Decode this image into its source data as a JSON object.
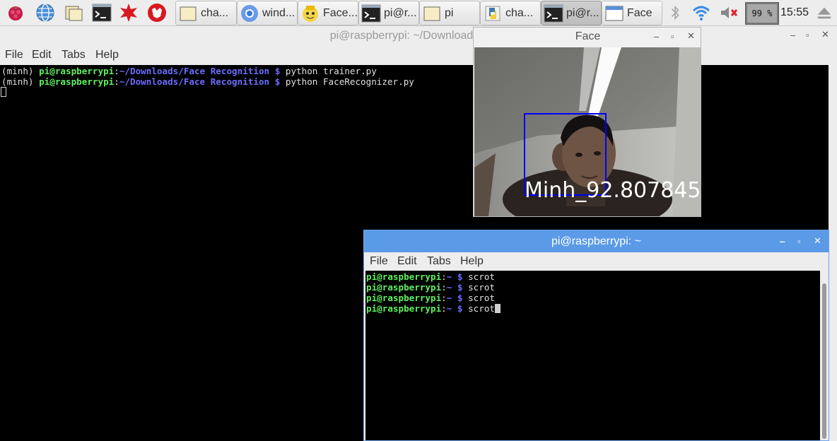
{
  "taskbar": {
    "launchers": [
      {
        "icon": "raspberry-menu-icon"
      },
      {
        "icon": "web-browser-icon"
      },
      {
        "icon": "file-manager-icon"
      },
      {
        "icon": "terminal-icon"
      },
      {
        "icon": "mathematica-icon"
      },
      {
        "icon": "wolfram-icon"
      }
    ],
    "tasks": [
      {
        "label": "cha...",
        "icon": "folder-icon",
        "active": false
      },
      {
        "label": "wind...",
        "icon": "chromium-icon",
        "active": false
      },
      {
        "label": "Face...",
        "icon": "geany-icon",
        "active": false
      },
      {
        "label": "pi@r...",
        "icon": "terminal-icon",
        "active": false
      },
      {
        "label": "pi",
        "icon": "folder-icon",
        "active": false
      },
      {
        "label": "cha...",
        "icon": "python-icon",
        "active": false
      },
      {
        "label": "pi@r...",
        "icon": "terminal-icon",
        "active": true
      },
      {
        "label": "Face",
        "icon": "window-icon",
        "active": false
      }
    ],
    "tray": {
      "bluetooth_icon": "bluetooth-icon",
      "wifi_icon": "wifi-icon",
      "volume_icon": "volume-muted-icon",
      "battery_text": "99 %",
      "battery_level": 0.99,
      "clock": "15:55",
      "eject_icon": "eject-icon"
    }
  },
  "bg_terminal": {
    "title": "pi@raspberrypi: ~/Downloads/Face",
    "menu": [
      "File",
      "Edit",
      "Tabs",
      "Help"
    ],
    "lines": [
      {
        "env": "(minh) ",
        "user": "pi@raspberrypi",
        "colon": ":",
        "path": "~/Downloads/Face Recognition",
        "prompt": " $ ",
        "cmd": "python trainer.py"
      },
      {
        "env": "(minh) ",
        "user": "pi@raspberrypi",
        "colon": ":",
        "path": "~/Downloads/Face Recognition",
        "prompt": " $ ",
        "cmd": "python FaceRecognizer.py"
      }
    ]
  },
  "face_window": {
    "title": "Face",
    "overlay_label": "Minh_92.807845",
    "box_color": "#0000ff"
  },
  "front_terminal": {
    "title": "pi@raspberrypi: ~",
    "menu": [
      "File",
      "Edit",
      "Tabs",
      "Help"
    ],
    "lines": [
      {
        "user": "pi@raspberrypi",
        "colon": ":",
        "path": "~",
        "prompt": " $ ",
        "cmd": "scrot"
      },
      {
        "user": "pi@raspberrypi",
        "colon": ":",
        "path": "~",
        "prompt": " $ ",
        "cmd": "scrot"
      },
      {
        "user": "pi@raspberrypi",
        "colon": ":",
        "path": "~",
        "prompt": " $ ",
        "cmd": "scrot"
      },
      {
        "user": "pi@raspberrypi",
        "colon": ":",
        "path": "~",
        "prompt": " $ ",
        "cmd": "scrot"
      }
    ]
  },
  "colors": {
    "prompt_green": "#5ff05f",
    "path_blue": "#6c6cff",
    "active_titlebar": "#5b9ae6"
  }
}
